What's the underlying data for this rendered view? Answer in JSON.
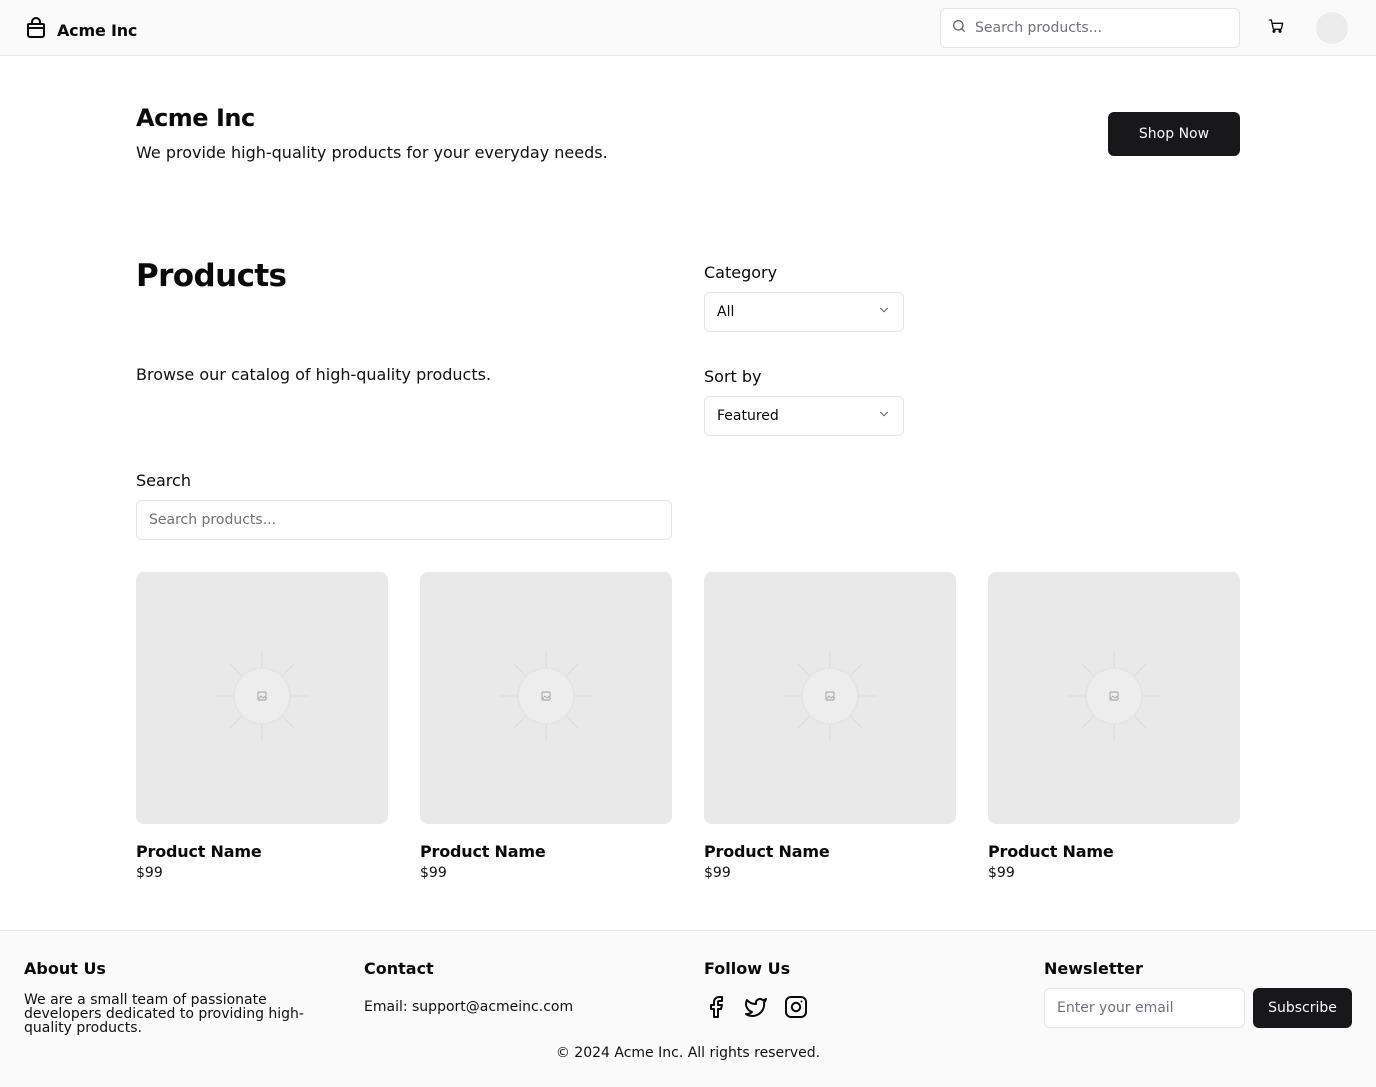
{
  "header": {
    "brand": "Acme Inc",
    "search_placeholder": "Search products..."
  },
  "hero": {
    "title": "Acme Inc",
    "subtitle": "We provide high-quality products for your everyday needs.",
    "cta_label": "Shop Now"
  },
  "products_section": {
    "title": "Products",
    "subtitle": "Browse our catalog of high-quality products.",
    "category_label": "Category",
    "category_value": "All",
    "sort_label": "Sort by",
    "sort_value": "Featured",
    "search_label": "Search",
    "search_placeholder": "Search products..."
  },
  "products": [
    {
      "name": "Product Name",
      "price": "$99"
    },
    {
      "name": "Product Name",
      "price": "$99"
    },
    {
      "name": "Product Name",
      "price": "$99"
    },
    {
      "name": "Product Name",
      "price": "$99"
    }
  ],
  "footer": {
    "about_title": "About Us",
    "about_text": "We are a small team of passionate developers dedicated to providing high-quality products.",
    "contact_title": "Contact",
    "contact_email": "Email: support@acmeinc.com",
    "follow_title": "Follow Us",
    "social_icons": [
      "facebook-icon",
      "twitter-icon",
      "instagram-icon"
    ],
    "newsletter_title": "Newsletter",
    "newsletter_placeholder": "Enter your email",
    "subscribe_label": "Subscribe",
    "copyright": "© 2024 Acme Inc. All rights reserved."
  },
  "colors": {
    "primary": "#18181b",
    "placeholder_bg": "#e9e9e9",
    "surface": "#f9faf9",
    "border": "#e4e4e7"
  }
}
